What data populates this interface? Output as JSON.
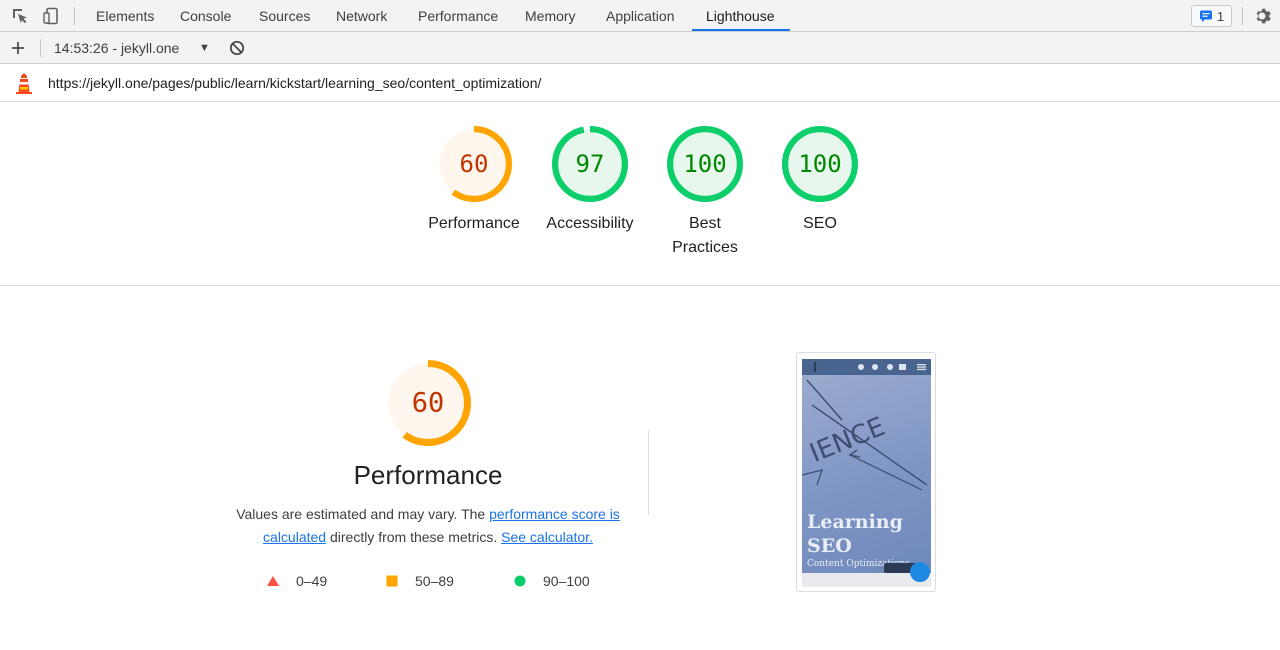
{
  "devtools": {
    "tabs": [
      "Elements",
      "Console",
      "Sources",
      "Network",
      "Performance",
      "Memory",
      "Application",
      "Lighthouse"
    ],
    "active_tab": "Lighthouse",
    "issues_count": "1",
    "accent": "#1a73e8"
  },
  "toolbar": {
    "report_label": "14:53:26 - jekyll.one"
  },
  "urlbar": {
    "url": "https://jekyll.one/pages/public/learn/kickstart/learning_seo/content_optimization/"
  },
  "gauges": [
    {
      "score": 60,
      "label": "Performance",
      "color": "#ffa400",
      "text_color": "#c33300",
      "fill": "#fff7ed"
    },
    {
      "score": 97,
      "label": "Accessibility",
      "color": "#0cce6b",
      "text_color": "#008800",
      "fill": "#e8f7ee"
    },
    {
      "score": 100,
      "label": "Best Practices",
      "color": "#0cce6b",
      "text_color": "#008800",
      "fill": "#e8f7ee"
    },
    {
      "score": 100,
      "label": "SEO",
      "color": "#0cce6b",
      "text_color": "#008800",
      "fill": "#e8f7ee"
    }
  ],
  "performance": {
    "score": 60,
    "title": "Performance",
    "desc_text1": "Values are estimated and may vary. The ",
    "desc_link1": "performance score is calculated",
    "desc_text2": " directly from these metrics. ",
    "desc_link2": "See calculator."
  },
  "legend": [
    {
      "range": "0–49",
      "shape": "triangle",
      "color": "#ff4e42"
    },
    {
      "range": "50–89",
      "shape": "square",
      "color": "#ffa400"
    },
    {
      "range": "90–100",
      "shape": "circle",
      "color": "#0cce6b"
    }
  ],
  "thumbnail": {
    "title_line1": "Learning",
    "title_line2": "SEO",
    "subtitle": "Content Optimizations"
  }
}
